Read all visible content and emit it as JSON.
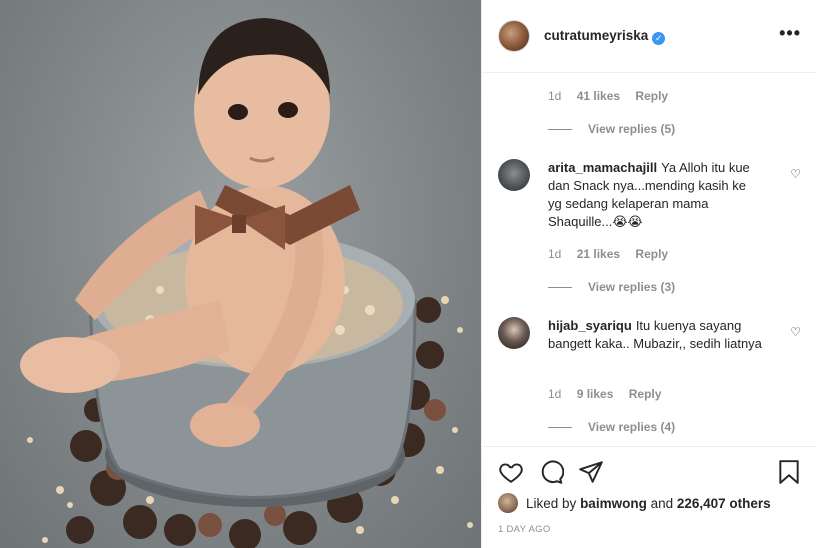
{
  "header": {
    "username": "cutratumeyriska",
    "more_icon": "more-horizontal-icon"
  },
  "comments": {
    "first_meta": {
      "age": "1d",
      "likes": "41 likes",
      "reply": "Reply"
    },
    "first_view_replies": "View replies (5)",
    "items": [
      {
        "username": "arita_mamachajill",
        "text": "Ya Alloh itu kue dan Snack nya...mending kasih ke yg sedang kelaperan mama Shaquille...😭😭",
        "age": "1d",
        "likes": "21 likes",
        "reply": "Reply",
        "view_replies": "View replies (3)"
      },
      {
        "username": "hijab_syariqu",
        "text": "Itu kuenya sayang bangett kaka.. Mubazir,, sedih liatnya",
        "age": "1d",
        "likes": "9 likes",
        "reply": "Reply",
        "view_replies": "View replies (4)"
      }
    ]
  },
  "actions": {
    "liked_by_prefix": "Liked by",
    "liked_by_user": "baimwong",
    "and": "and",
    "others": "226,407 others",
    "time_ago": "1 DAY AGO"
  },
  "colors": {
    "accent": "#3897f0",
    "muted": "#8e8e8e",
    "text": "#262626"
  }
}
